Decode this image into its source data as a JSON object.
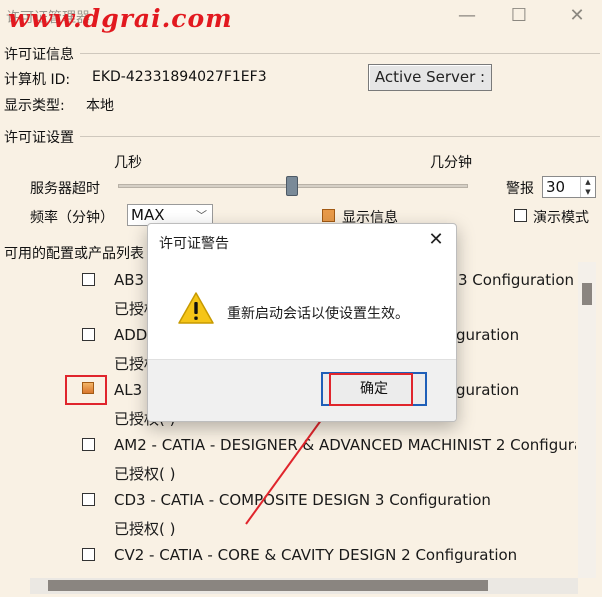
{
  "window": {
    "title": "许可证管理器",
    "watermark": "www.dgrai.com"
  },
  "license_info": {
    "section_title": "许可证信息",
    "computer_id_label": "计算机 ID:",
    "computer_id_value": "EKD-42331894027F1EF3",
    "display_type_label": "显示类型:",
    "display_type_value": "本地",
    "active_server_button": "Active Server :"
  },
  "license_settings": {
    "section_title": "许可证设置",
    "slider_min_label": "几秒",
    "slider_max_label": "几分钟",
    "server_timeout_label": "服务器超时",
    "slider_level": 0.5,
    "alarm_label": "警报",
    "alarm_value": "30",
    "frequency_label": "频率（分钟）",
    "frequency_value": "MAX",
    "show_info_label": "显示信息",
    "demo_mode_label": "演示模式"
  },
  "config_list": {
    "section_title": "可用的配置或产品列表",
    "items": [
      {
        "name_prefix": "AB3",
        "name_suffix": "3 Configuration",
        "status": "已授权"
      },
      {
        "name_prefix": "ADD",
        "name_suffix": "guration",
        "status": "已授权"
      },
      {
        "name_prefix": "AL3",
        "name_suffix": "guration",
        "status": "已授权( )"
      },
      {
        "name": "AM2 - CATIA - DESIGNER & ADVANCED MACHINIST 2 Configuratio",
        "status": "已授权( )"
      },
      {
        "name": "CD3 - CATIA - COMPOSITE DESIGN 3 Configuration",
        "status": "已授权( )"
      },
      {
        "name": "CV2 - CATIA - CORE & CAVITY DESIGN 2 Configuration"
      }
    ]
  },
  "dialog": {
    "title": "许可证警告",
    "message": "重新启动会话以使设置生效。",
    "ok_button": "确定"
  },
  "colors": {
    "accent_red": "#e0252c",
    "checkbox_orange": "#e89a49",
    "background": "#f9f1e4"
  }
}
